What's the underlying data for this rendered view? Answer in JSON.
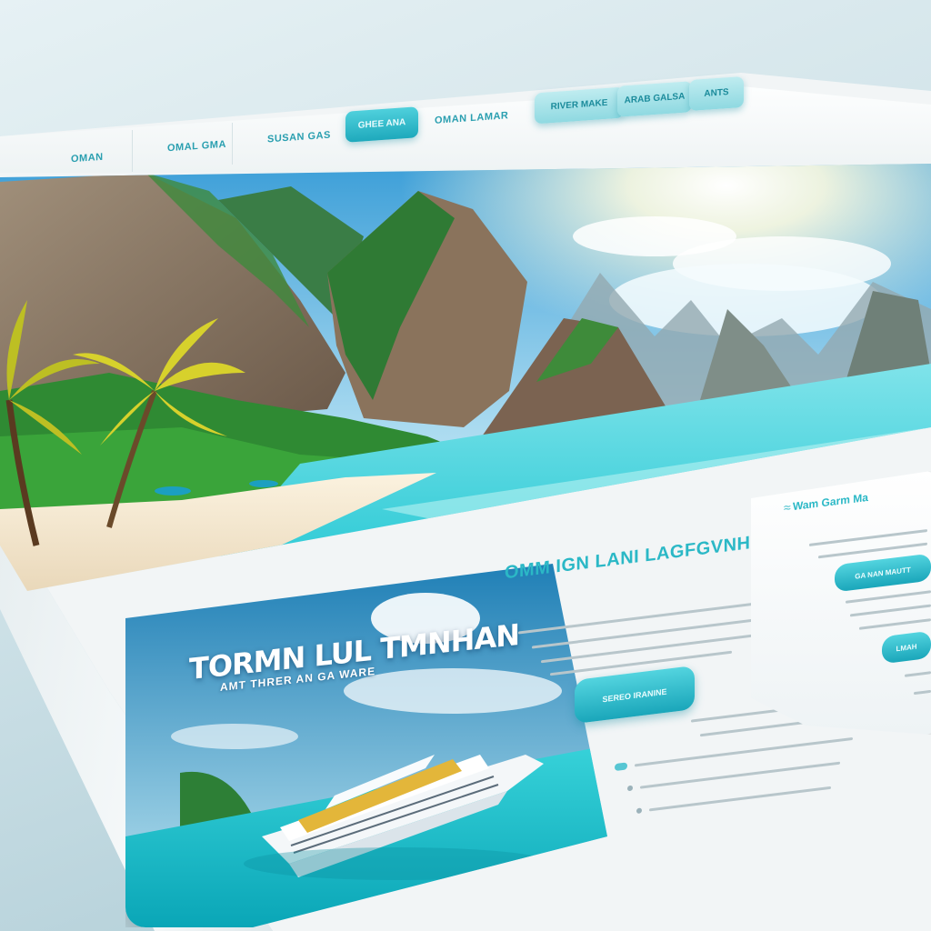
{
  "nav": {
    "items": [
      "OMAN",
      "OMAL GMA",
      "SUSAN GAS",
      "GHEE ANA",
      "OMAN LAMAR",
      "RIVER MAKE",
      "ARAB GALSA",
      "ANTS"
    ]
  },
  "hero": {
    "alt": ""
  },
  "feature": {
    "title": "TORMN LUL TMNHAN",
    "subtitle": "AMT THRER AN GA WARE"
  },
  "intro": {
    "heading": "OMM IGN LANI LAGFGVNHAKK",
    "cta_label": "SEREO IRANINE"
  },
  "panel": {
    "title": "Wam Garm Ma",
    "button1": "GA NAN MAUTT",
    "button2": "LMAH"
  },
  "colors": {
    "accent": "#2bb8c6",
    "accent_dark": "#1aa6ba",
    "page": "#f2f5f6"
  }
}
